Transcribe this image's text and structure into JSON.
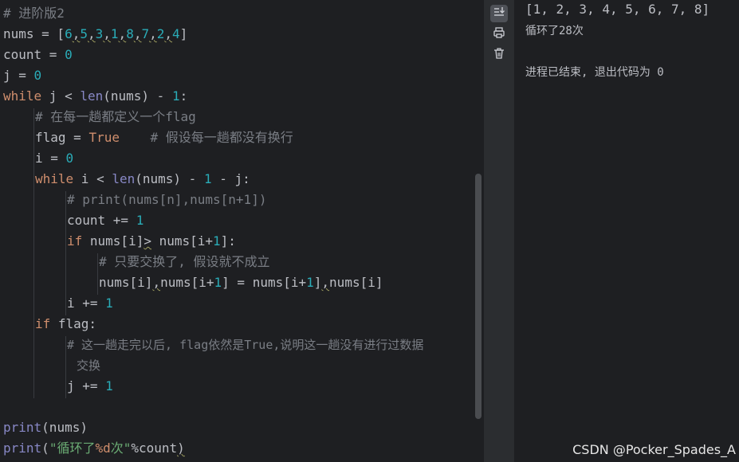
{
  "editor": {
    "comment_title": "# 进阶版2",
    "l_nums_a": "nums = [",
    "n6": "6",
    "n5": "5",
    "n3": "3",
    "n1": "1",
    "n8": "8",
    "n7": "7",
    "n2": "2",
    "n4": "4",
    "comma": ",",
    "rbracket": "]",
    "l_count_a": "count = ",
    "zero": "0",
    "one": "1",
    "l_j_a": "j = ",
    "kw_while": "while",
    "l_while1_b": " j < ",
    "bi_len": "len",
    "l_while1_c": "(nums) - ",
    "colon": ":",
    "comment_flag": "# 在每一趟都定义一个flag",
    "l_flag_a": "flag = ",
    "kw_true": "True",
    "comment_assume": "# 假设每一趟都没有换行",
    "l_i_a": "i = ",
    "l_while2_b": " i < ",
    "l_while2_c": "(nums) - ",
    "l_while2_d": " - j:",
    "comment_print": "# print(nums[n],nums[n+1])",
    "l_countinc": "count += ",
    "kw_if": "if",
    "l_if_b": " nums[i]",
    "gt": ">",
    "l_if_c": " nums[i+",
    "l_if_d": "]:",
    "comment_swap": "# 只要交换了, 假设就不成立",
    "l_swap_a": "nums[i]",
    "l_swap_b": "nums[i+",
    "l_swap_c": "] = nums[i+",
    "l_swap_d": "]",
    "l_swap_e": "nums[i]",
    "l_iinc": "i += ",
    "l_ifflag": " flag:",
    "comment_after1": "# 这一趟走完以后, flag依然是True,说明这一趟没有进行过数据",
    "comment_after2": "交换",
    "l_jinc": "j += ",
    "bi_print": "print",
    "l_print1_b": "(nums)",
    "l_print2_b": "(",
    "str_a": "\"循环了",
    "str_fmt": "%d",
    "str_b": "次\"",
    "l_print2_c": "%count",
    "l_print2_d": ")"
  },
  "toolbar": {
    "scroll_icon": "soft-wrap-scroll-icon",
    "print_icon": "printer-icon",
    "trash_icon": "trash-icon"
  },
  "console": {
    "line1": "[1, 2, 3, 4, 5, 6, 7, 8]",
    "line2": "循环了28次",
    "line3": "进程已结束, 退出代码为 0"
  },
  "watermark": "CSDN @Pocker_Spades_A",
  "colors": {
    "background": "#1e1f22",
    "keyword": "#cf8e6d",
    "number": "#2aacb8",
    "builtin": "#8888c6",
    "string": "#6aab73",
    "comment": "#7a7e85"
  }
}
